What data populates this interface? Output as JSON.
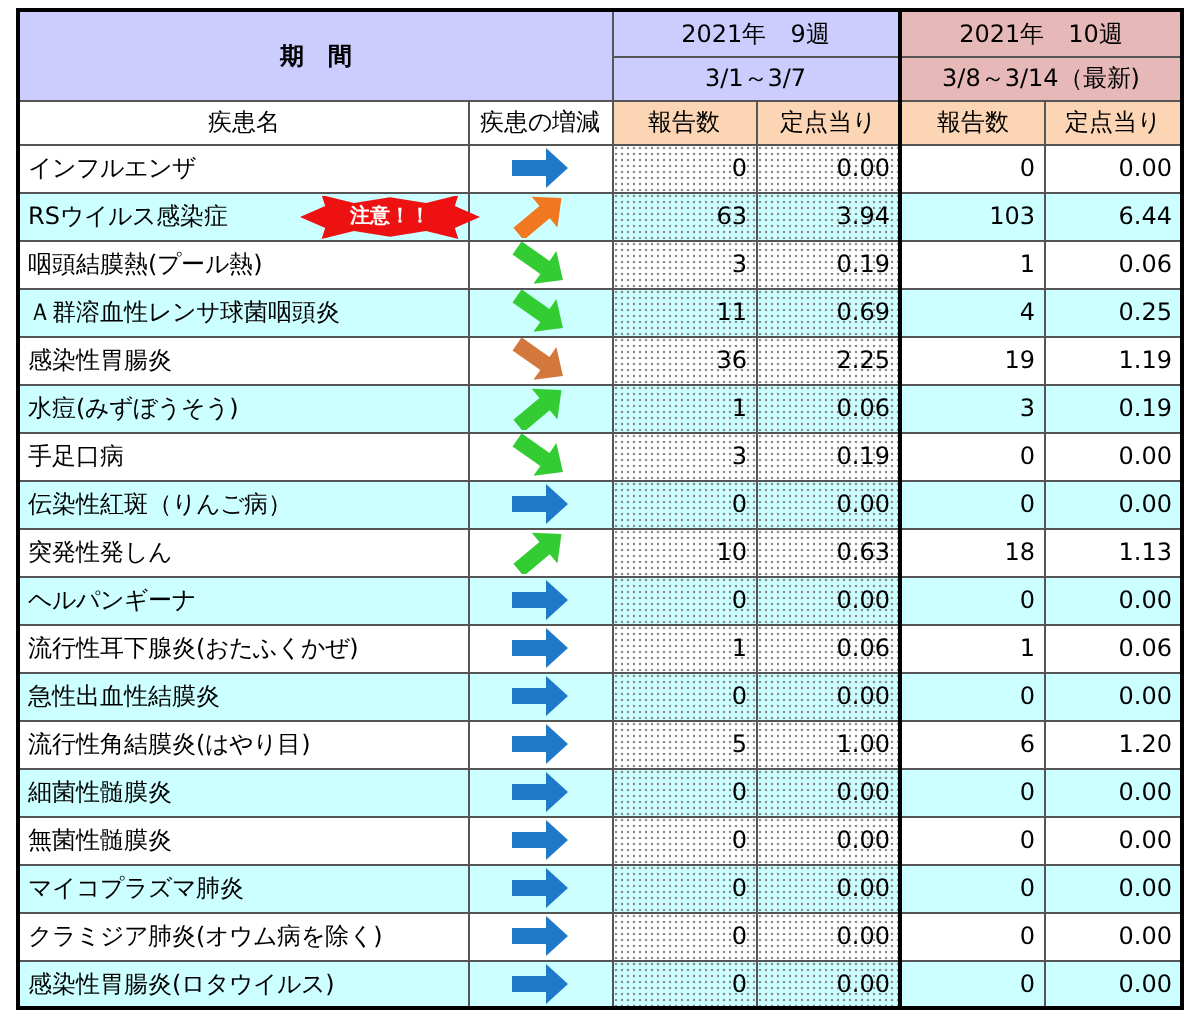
{
  "header": {
    "period_label": "期　間",
    "week_a": {
      "title": "2021年　9週",
      "range": "3/1～3/7"
    },
    "week_b": {
      "title": "2021年　10週",
      "range": "3/8～3/14（最新)"
    },
    "columns": [
      "疾患名",
      "疾患の増減",
      "報告数",
      "定点当り",
      "報告数",
      "定点当り"
    ]
  },
  "rows": [
    {
      "name": "インフルエンザ",
      "trend": {
        "kind": "flat",
        "color": "#1f78c8"
      },
      "a_count": "0",
      "a_rate": "0.00",
      "b_count": "0",
      "b_rate": "0.00"
    },
    {
      "name": "RSウイルス感染症",
      "badge": "注意！！",
      "trend": {
        "kind": "up",
        "color": "#f07820"
      },
      "a_count": "63",
      "a_rate": "3.94",
      "b_count": "103",
      "b_rate": "6.44"
    },
    {
      "name": "咽頭結膜熱(プール熱)",
      "trend": {
        "kind": "down",
        "color": "#33cc33"
      },
      "a_count": "3",
      "a_rate": "0.19",
      "b_count": "1",
      "b_rate": "0.06"
    },
    {
      "name": "Ａ群溶血性レンサ球菌咽頭炎",
      "trend": {
        "kind": "down",
        "color": "#33cc33"
      },
      "a_count": "11",
      "a_rate": "0.69",
      "b_count": "4",
      "b_rate": "0.25"
    },
    {
      "name": "感染性胃腸炎",
      "trend": {
        "kind": "down",
        "color": "#d2783c"
      },
      "a_count": "36",
      "a_rate": "2.25",
      "b_count": "19",
      "b_rate": "1.19"
    },
    {
      "name": "水痘(みずぼうそう)",
      "trend": {
        "kind": "up",
        "color": "#33cc33"
      },
      "a_count": "1",
      "a_rate": "0.06",
      "b_count": "3",
      "b_rate": "0.19"
    },
    {
      "name": "手足口病",
      "trend": {
        "kind": "down",
        "color": "#33cc33"
      },
      "a_count": "3",
      "a_rate": "0.19",
      "b_count": "0",
      "b_rate": "0.00"
    },
    {
      "name": "伝染性紅斑（りんご病）",
      "trend": {
        "kind": "flat",
        "color": "#1f78c8"
      },
      "a_count": "0",
      "a_rate": "0.00",
      "b_count": "0",
      "b_rate": "0.00"
    },
    {
      "name": "突発性発しん",
      "trend": {
        "kind": "up",
        "color": "#33cc33"
      },
      "a_count": "10",
      "a_rate": "0.63",
      "b_count": "18",
      "b_rate": "1.13"
    },
    {
      "name": "ヘルパンギーナ",
      "trend": {
        "kind": "flat",
        "color": "#1f78c8"
      },
      "a_count": "0",
      "a_rate": "0.00",
      "b_count": "0",
      "b_rate": "0.00"
    },
    {
      "name": "流行性耳下腺炎(おたふくかぜ)",
      "trend": {
        "kind": "flat",
        "color": "#1f78c8"
      },
      "a_count": "1",
      "a_rate": "0.06",
      "b_count": "1",
      "b_rate": "0.06"
    },
    {
      "name": "急性出血性結膜炎",
      "trend": {
        "kind": "flat",
        "color": "#1f78c8"
      },
      "a_count": "0",
      "a_rate": "0.00",
      "b_count": "0",
      "b_rate": "0.00"
    },
    {
      "name": "流行性角結膜炎(はやり目)",
      "trend": {
        "kind": "flat",
        "color": "#1f78c8"
      },
      "a_count": "5",
      "a_rate": "1.00",
      "b_count": "6",
      "b_rate": "1.20"
    },
    {
      "name": "細菌性髄膜炎",
      "trend": {
        "kind": "flat",
        "color": "#1f78c8"
      },
      "a_count": "0",
      "a_rate": "0.00",
      "b_count": "0",
      "b_rate": "0.00"
    },
    {
      "name": "無菌性髄膜炎",
      "trend": {
        "kind": "flat",
        "color": "#1f78c8"
      },
      "a_count": "0",
      "a_rate": "0.00",
      "b_count": "0",
      "b_rate": "0.00"
    },
    {
      "name": "マイコプラズマ肺炎",
      "trend": {
        "kind": "flat",
        "color": "#1f78c8"
      },
      "a_count": "0",
      "a_rate": "0.00",
      "b_count": "0",
      "b_rate": "0.00"
    },
    {
      "name": "クラミジア肺炎(オウム病を除く)",
      "trend": {
        "kind": "flat",
        "color": "#1f78c8"
      },
      "a_count": "0",
      "a_rate": "0.00",
      "b_count": "0",
      "b_rate": "0.00"
    },
    {
      "name": "感染性胃腸炎(ロタウイルス)",
      "trend": {
        "kind": "flat",
        "color": "#1f78c8"
      },
      "a_count": "0",
      "a_rate": "0.00",
      "b_count": "0",
      "b_rate": "0.00"
    }
  ]
}
